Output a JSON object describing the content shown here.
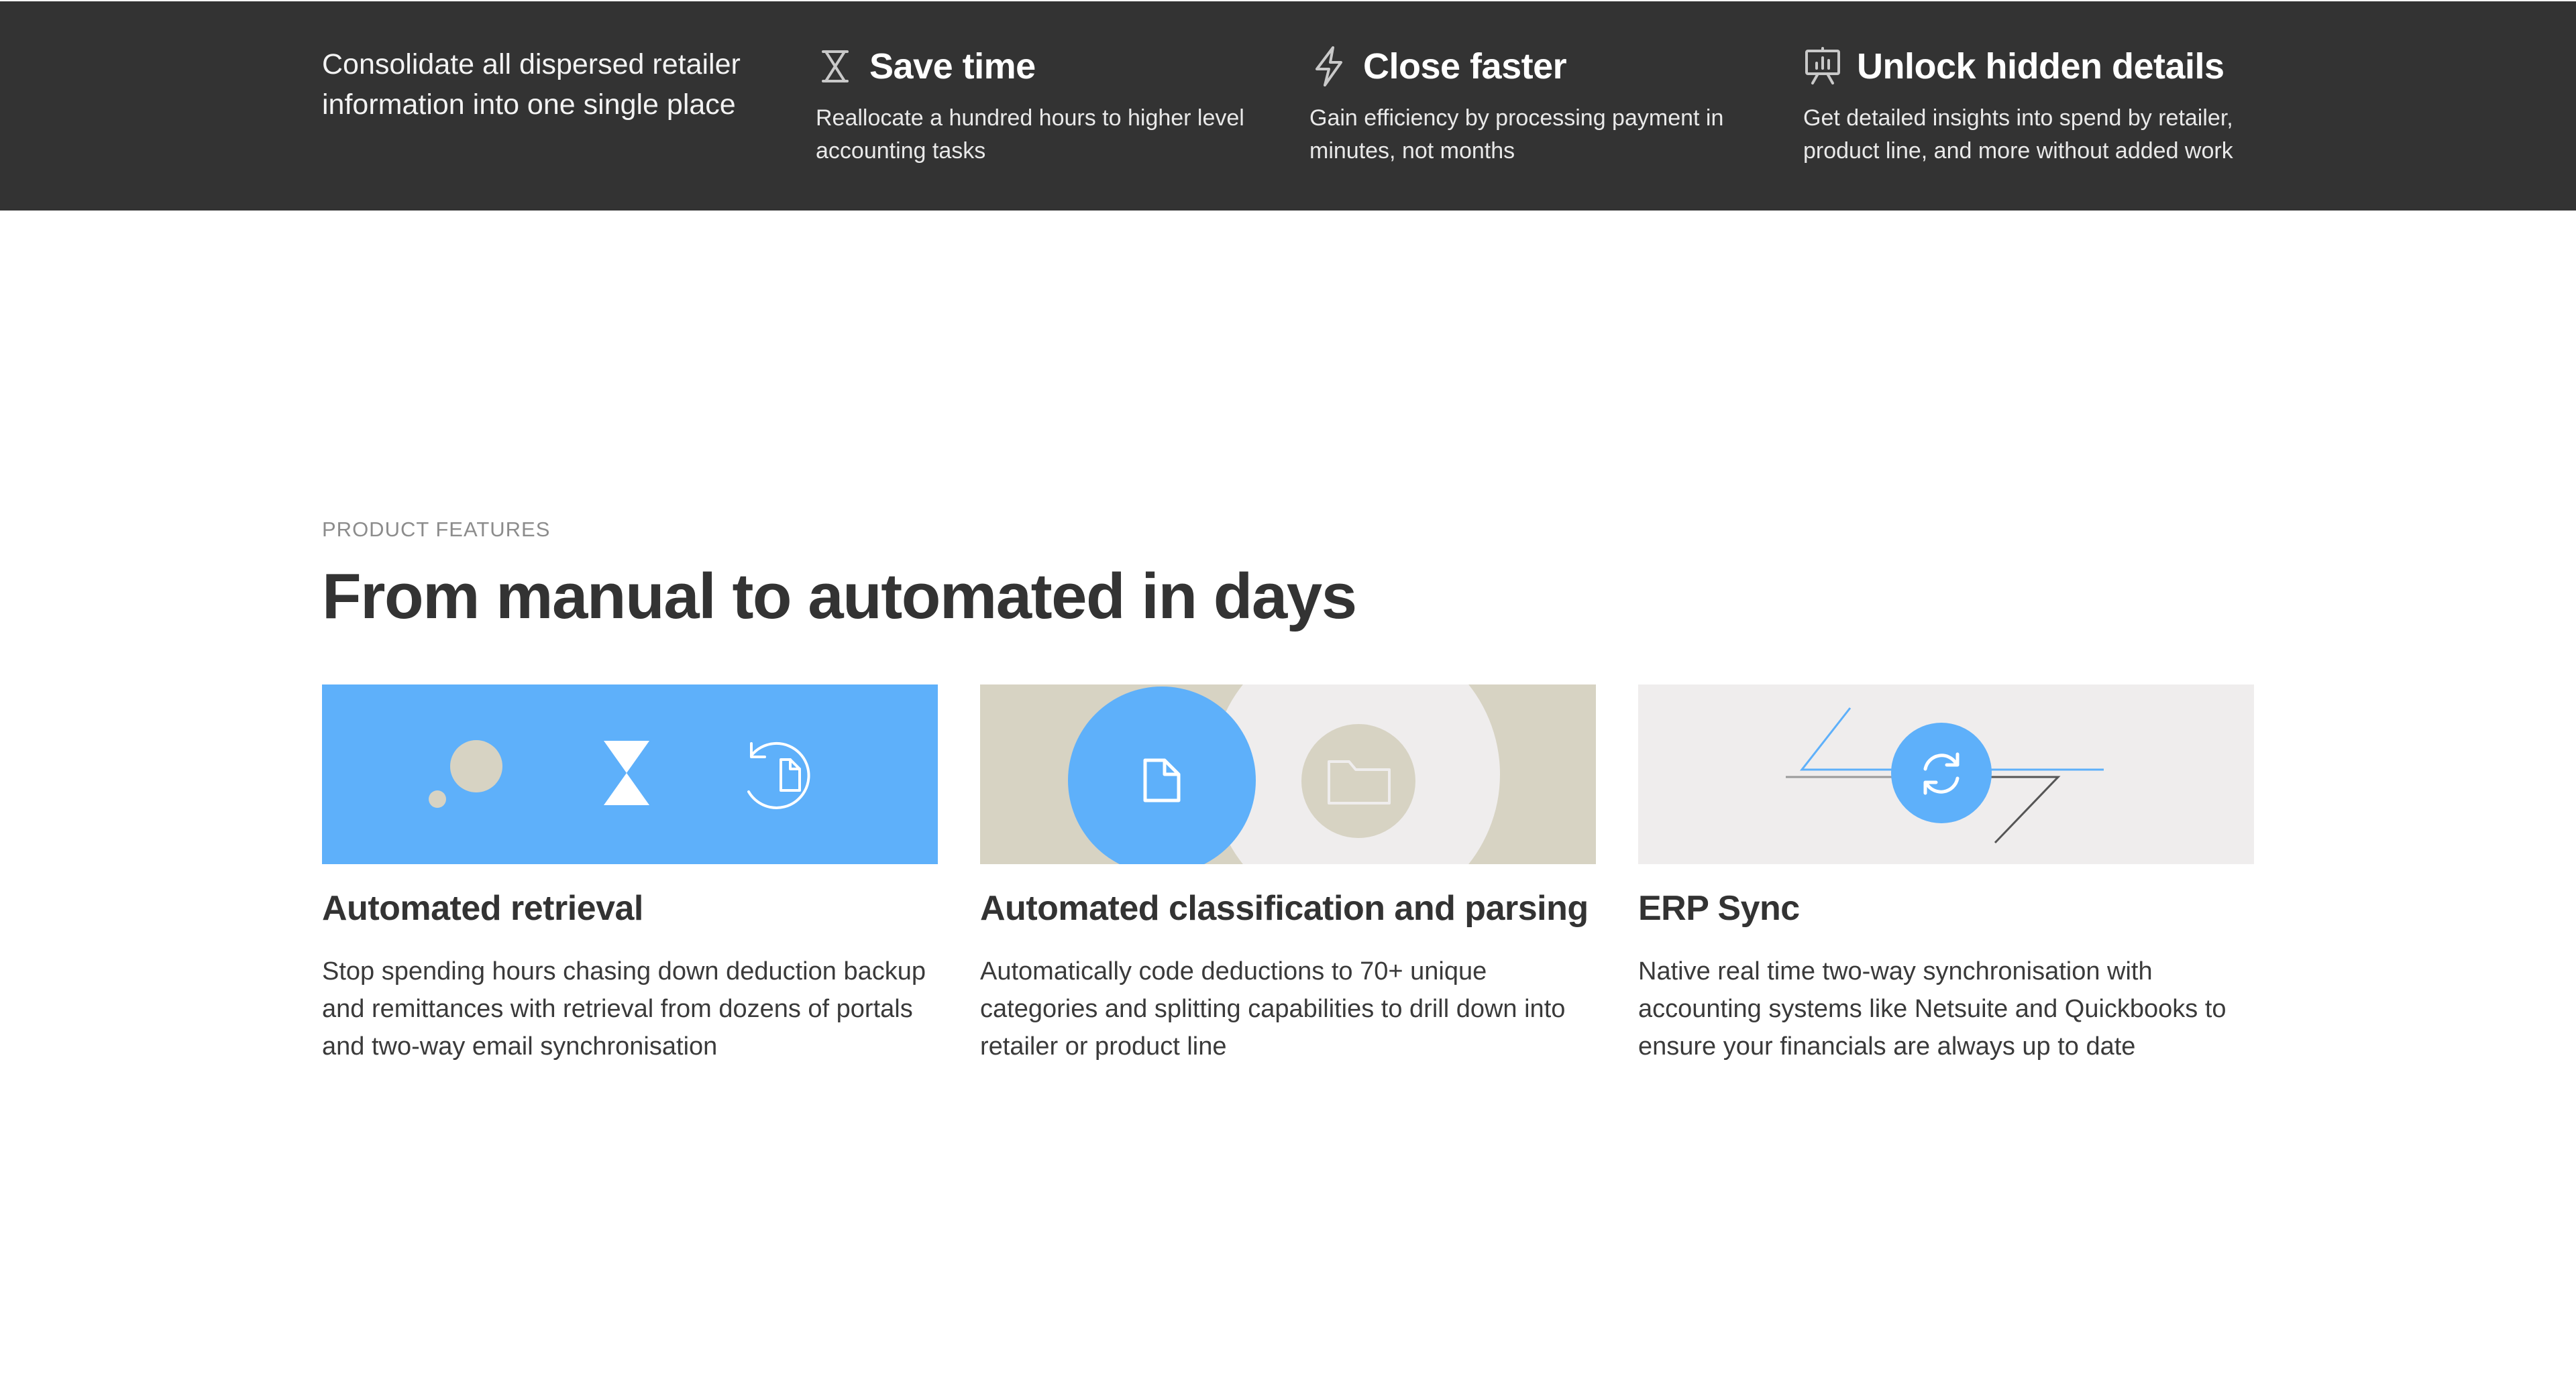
{
  "colors": {
    "band": "#333333",
    "accent_blue": "#5eb0fa",
    "beige": "#d7d3c3",
    "light_gray": "#efeded"
  },
  "intro": "Consolidate all dispersed retailer information into one single place",
  "benefits": [
    {
      "icon": "hourglass-icon",
      "title": "Save time",
      "desc": "Reallocate a hundred hours to higher level accounting tasks"
    },
    {
      "icon": "lightning-icon",
      "title": "Close faster",
      "desc": "Gain efficiency by processing payment in minutes, not months"
    },
    {
      "icon": "presentation-chart-icon",
      "title": "Unlock hidden details",
      "desc": "Get detailed insights into spend by retailer, product line, and more without added work"
    }
  ],
  "features": {
    "eyebrow": "PRODUCT FEATURES",
    "headline": "From manual to automated in days",
    "cards": [
      {
        "title": "Automated retrieval",
        "desc": "Stop spending hours chasing down deduction backup and remittances with retrieval from dozens of portals and two-way email synchronisation"
      },
      {
        "title": "Automated classification and parsing",
        "desc": "Automatically code deductions to 70+ unique categories and splitting capabilities to drill down into retailer or product line"
      },
      {
        "title": "ERP Sync",
        "desc": "Native real time two-way synchronisation with accounting systems like Netsuite and Quickbooks to ensure your financials are always up to date"
      }
    ]
  }
}
